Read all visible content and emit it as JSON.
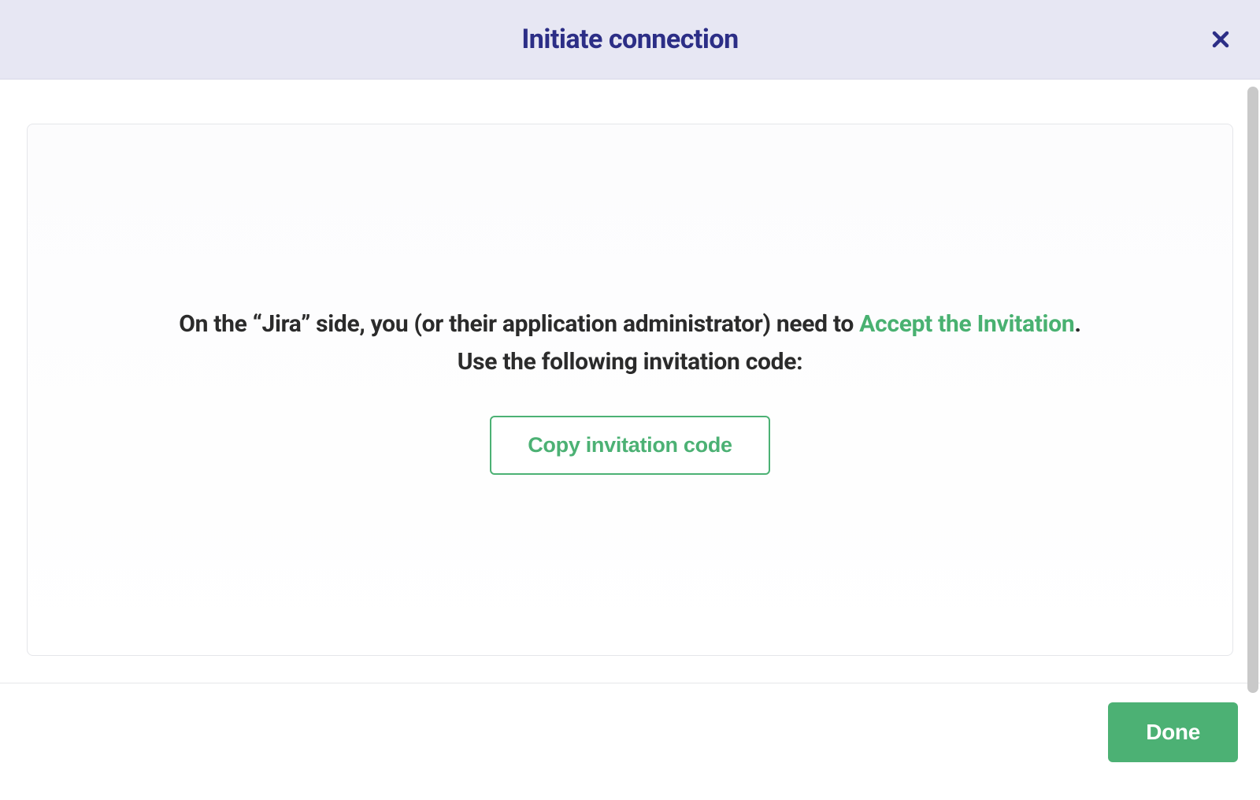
{
  "header": {
    "title": "Initiate connection"
  },
  "content": {
    "line1_prefix": "On the “Jira” side, you (or their application administrator) need to ",
    "line1_link": "Accept the Invitation",
    "line1_suffix": ".",
    "line2": "Use the following invitation code:",
    "copy_button": "Copy invitation code"
  },
  "footer": {
    "done": "Done"
  }
}
